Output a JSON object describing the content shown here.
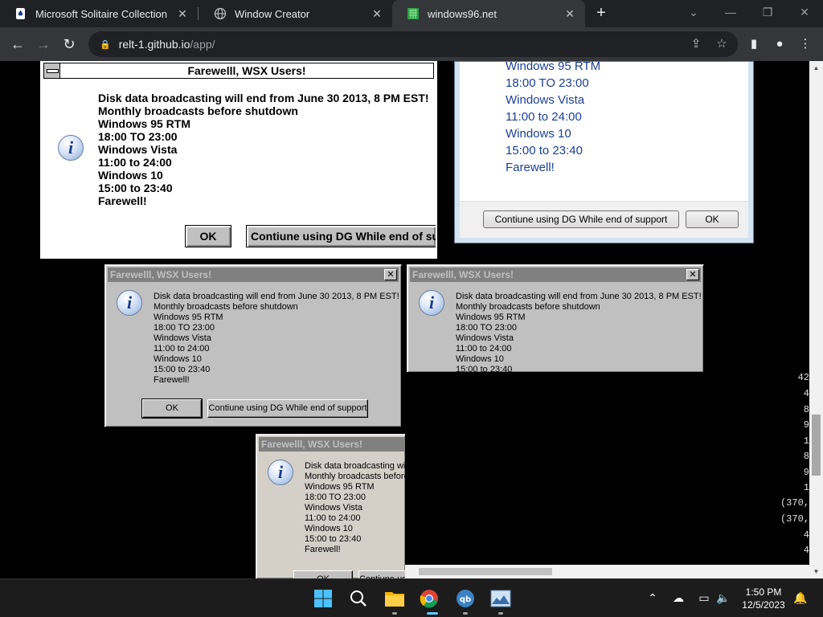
{
  "browser": {
    "tabs": [
      {
        "label": "Microsoft Solitaire Collection",
        "icon": "solitaire-icon"
      },
      {
        "label": "Window Creator",
        "icon": "globe-icon"
      },
      {
        "label": "windows96.net",
        "icon": "windows96-icon"
      }
    ],
    "url_host": "relt-1.github.io",
    "url_path": "/app/"
  },
  "dialog_message": {
    "title": "Farewelll, WSX Users!",
    "lines": [
      "Disk data broadcasting will end from June 30 2013, 8 PM EST!",
      "Monthly broadcasts before shutdown",
      "Windows 95 RTM",
      "18:00 TO 23:00",
      "Windows Vista",
      "11:00 to 24:00",
      "Windows 10",
      "15:00 to 23:40",
      "Farewell!"
    ],
    "ok_label": "OK",
    "continue_label": "Contiune using DG While end of support"
  },
  "win7_lines": [
    "Windows 95 RTM",
    "18:00 TO 23:00",
    "Windows Vista",
    "11:00 to 24:00",
    "Windows 10",
    "15:00 to 23:40",
    "Farewell!"
  ],
  "console_lines": [
    "42",
    "4",
    "8",
    "9",
    "1",
    "8",
    "9",
    "1",
    "(370,",
    "(370,",
    "4",
    "4"
  ],
  "taskbar": {
    "apps": [
      "start-icon",
      "search-icon",
      "file-explorer-icon",
      "chrome-icon",
      "qbittorrent-icon",
      "photos-icon"
    ],
    "time": "1:50 PM",
    "date": "12/5/2023"
  }
}
